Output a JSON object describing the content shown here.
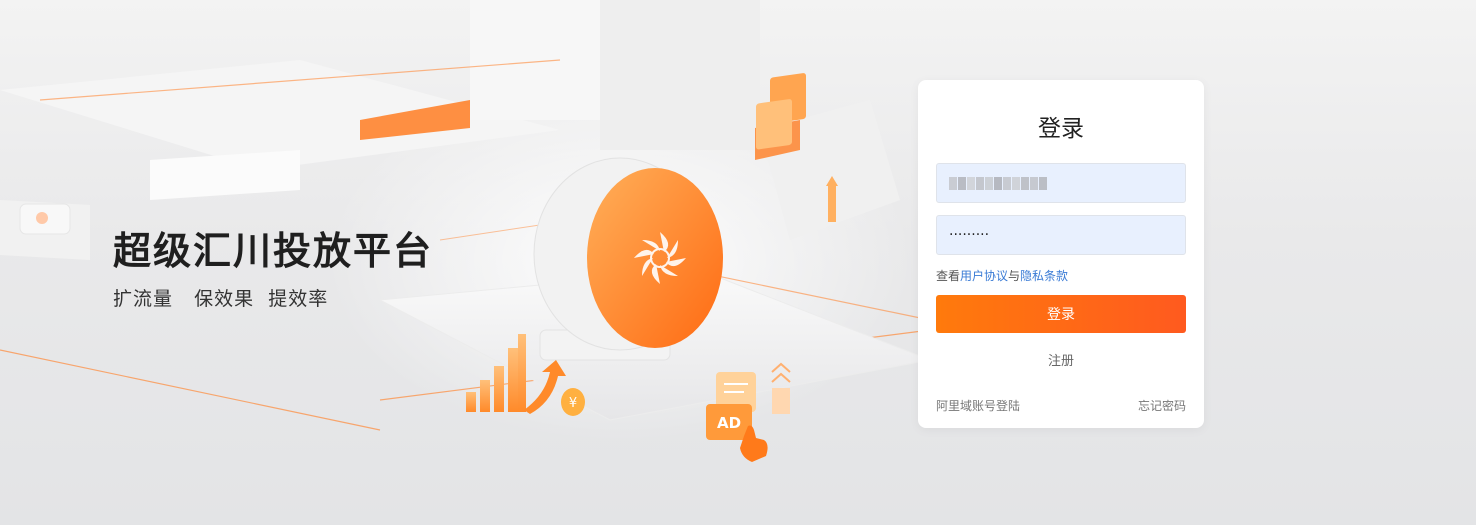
{
  "hero": {
    "title": "超级汇川投放平台",
    "subtitle": "扩流量   保效果  提效率",
    "illustration": {
      "ad_tile_label": "AD",
      "icons": [
        "bar-growth-icon",
        "up-arrow-icon",
        "coin-icon",
        "ad-document-icon",
        "pointer-hand-icon",
        "chevron-up-icon",
        "swirl-logo-icon"
      ]
    }
  },
  "login": {
    "title": "登录",
    "username_masked": true,
    "password_value": "·········",
    "agreement_prefix": "查看",
    "agreement_link": "用户协议",
    "agreement_join": "与",
    "privacy_link": "隐私条款",
    "submit_label": "登录",
    "register_label": "注册",
    "ali_login_label": "阿里域账号登陆",
    "forgot_label": "忘记密码"
  },
  "colors": {
    "accent_start": "#ff7a0c",
    "accent_end": "#ff5a1f",
    "link": "#3a7bd5",
    "input_bg": "#e8f0fe"
  }
}
